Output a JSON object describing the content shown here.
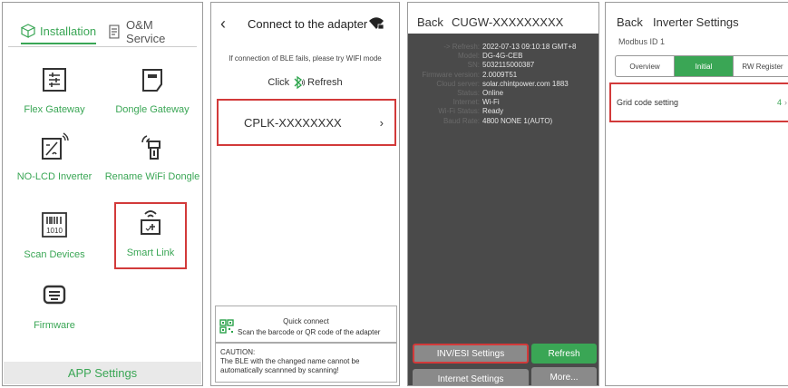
{
  "panel1": {
    "tabs": [
      {
        "label": "Installation",
        "icon": "box-icon",
        "active": true
      },
      {
        "label": "O&M Service",
        "icon": "document-icon",
        "active": false
      }
    ],
    "items": [
      {
        "label": "Flex Gateway",
        "icon": "flex-gateway-icon"
      },
      {
        "label": "Dongle Gateway",
        "icon": "dongle-gateway-icon"
      },
      {
        "label": "NO-LCD Inverter",
        "icon": "inverter-icon"
      },
      {
        "label": "Rename WiFi Dongle",
        "icon": "rename-wifi-dongle-icon"
      },
      {
        "label": "Scan Devices",
        "icon": "barcode-icon",
        "icon_text": "1010"
      },
      {
        "label": "Smart Link",
        "icon": "smart-link-icon"
      },
      {
        "label": "Firmware",
        "icon": "firmware-icon"
      }
    ],
    "bottom": "APP Settings"
  },
  "panel2": {
    "title": "Connect to the adapter",
    "hint": "If connection of BLE fails, please try WIFI mode",
    "click": "Click",
    "refresh": "Refresh",
    "device": "CPLK-XXXXXXXX",
    "quick_title": "Quick connect",
    "quick_sub": "Scan the barcode or QR code of the adapter",
    "caution_title": "CAUTION:",
    "caution_text": "The BLE with the changed name cannot be automatically scannned by scanning!"
  },
  "panel3": {
    "back": "Back",
    "title": "CUGW-XXXXXXXXX",
    "info": [
      {
        "k": "-> Refresh:",
        "v": "2022-07-13 09:10:18 GMT+8"
      },
      {
        "k": "Model:",
        "v": "DG-4G-CEB"
      },
      {
        "k": "SN:",
        "v": "5032115000387"
      },
      {
        "k": "Firmware version:",
        "v": "2.0009T51"
      },
      {
        "k": "Cloud server:",
        "v": "solar.chintpower.com 1883"
      },
      {
        "k": "Status:",
        "v": "Online"
      },
      {
        "k": "Internet:",
        "v": "Wi-Fi"
      },
      {
        "k": "Wi-Fi Status:",
        "v": "Ready"
      },
      {
        "k": "Baud Rate:",
        "v": "4800 NONE 1(AUTO)"
      }
    ],
    "buttons": {
      "inv": "INV/ESI Settings",
      "refresh": "Refresh",
      "internet": "Internet Settings",
      "more": "More..."
    }
  },
  "panel4": {
    "back": "Back",
    "title": "Inverter Settings",
    "modbus": "Modbus ID 1",
    "tabs": [
      "Overview",
      "Initial",
      "RW Register"
    ],
    "setting_label": "Grid code setting",
    "setting_value": "4"
  },
  "colors": {
    "accent": "#3aa655",
    "highlight": "#d23a3a",
    "dark_bg": "#4a4a4a"
  }
}
